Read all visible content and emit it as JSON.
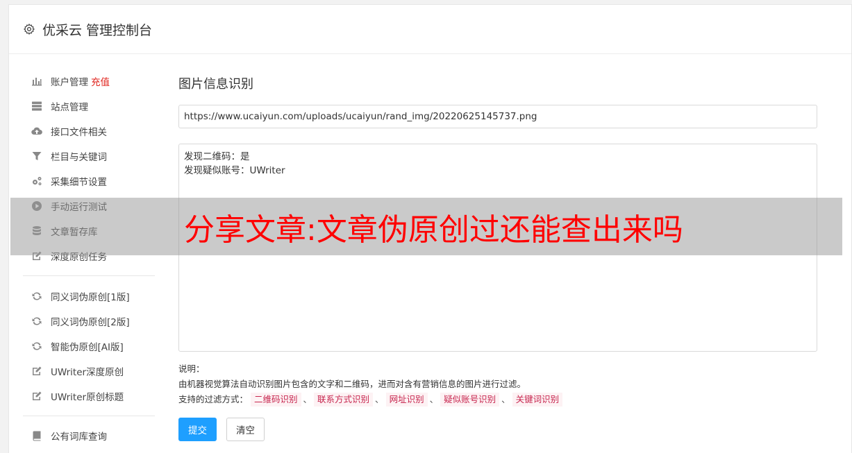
{
  "header": {
    "title": "优采云 管理控制台",
    "icon": "gear-icon"
  },
  "sidebar": {
    "items": [
      {
        "label": "账户管理",
        "extra": "充值",
        "icon": "bar-chart-icon"
      },
      {
        "label": "站点管理",
        "icon": "server-icon"
      },
      {
        "label": "接口文件相关",
        "icon": "cloud-upload-icon"
      },
      {
        "label": "栏目与关键词",
        "icon": "filter-icon"
      },
      {
        "label": "采集细节设置",
        "icon": "gears-icon"
      },
      {
        "label": "手动运行测试",
        "icon": "play-circle-icon"
      },
      {
        "label": "文章暂存库",
        "icon": "database-icon"
      },
      {
        "label": "深度原创任务",
        "icon": "edit-icon"
      },
      {
        "label": "同义词伪原创[1版]",
        "icon": "refresh-icon"
      },
      {
        "label": "同义词伪原创[2版]",
        "icon": "refresh-icon"
      },
      {
        "label": "智能伪原创[AI版]",
        "icon": "refresh-icon"
      },
      {
        "label": "UWriter深度原创",
        "icon": "edit-icon"
      },
      {
        "label": "UWriter原创标题",
        "icon": "edit-icon"
      },
      {
        "label": "公有词库查询",
        "icon": "book-icon"
      }
    ]
  },
  "main": {
    "title": "图片信息识别",
    "url_value": "https://www.ucaiyun.com/uploads/ucaiyun/rand_img/20220625145737.png",
    "result_lines": [
      "发现二维码：是",
      "发现疑似账号：UWriter"
    ],
    "desc_title": "说明：",
    "desc_text": "由机器视觉算法自动识别图片包含的文字和二维码，进而对含有营销信息的图片进行过滤。",
    "filter_label": "支持的过滤方式：",
    "filters": [
      "二维码识别",
      "联系方式识别",
      "网址识别",
      "疑似账号识别",
      "关键词识别"
    ],
    "separator": "、",
    "submit_label": "提交",
    "clear_label": "清空"
  },
  "overlay": {
    "text": "分享文章:文章伪原创过还能查出来吗"
  }
}
